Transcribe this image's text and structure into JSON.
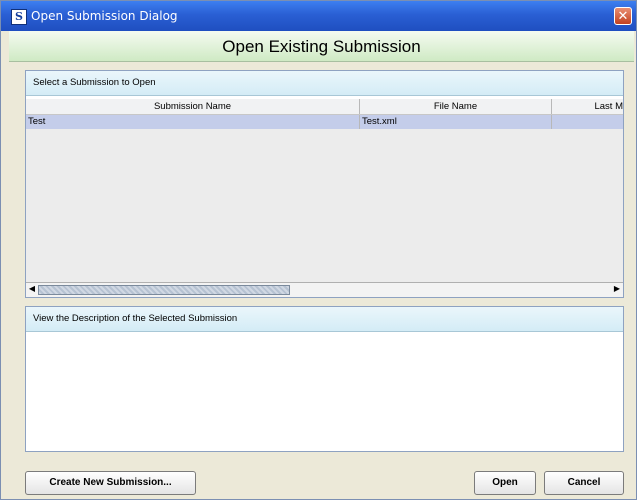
{
  "window": {
    "title": "Open Submission Dialog",
    "app_icon_letter": "S"
  },
  "header": {
    "title": "Open Existing Submission"
  },
  "select_panel": {
    "title": "Select a Submission to Open",
    "columns": [
      "Submission Name",
      "File Name",
      "Last M"
    ],
    "rows": [
      {
        "name": "Test",
        "file": "Test.xml",
        "last_modified": ""
      }
    ]
  },
  "description_panel": {
    "title": "View the Description of the Selected Submission"
  },
  "buttons": {
    "create_new": "Create New Submission...",
    "open": "Open",
    "cancel": "Cancel"
  },
  "colors": {
    "titlebar_blue": "#2a5fd4",
    "header_green": "#cfeac4",
    "selected_row": "#c4cdea",
    "panel_title_bg": "#d4ecf6"
  }
}
